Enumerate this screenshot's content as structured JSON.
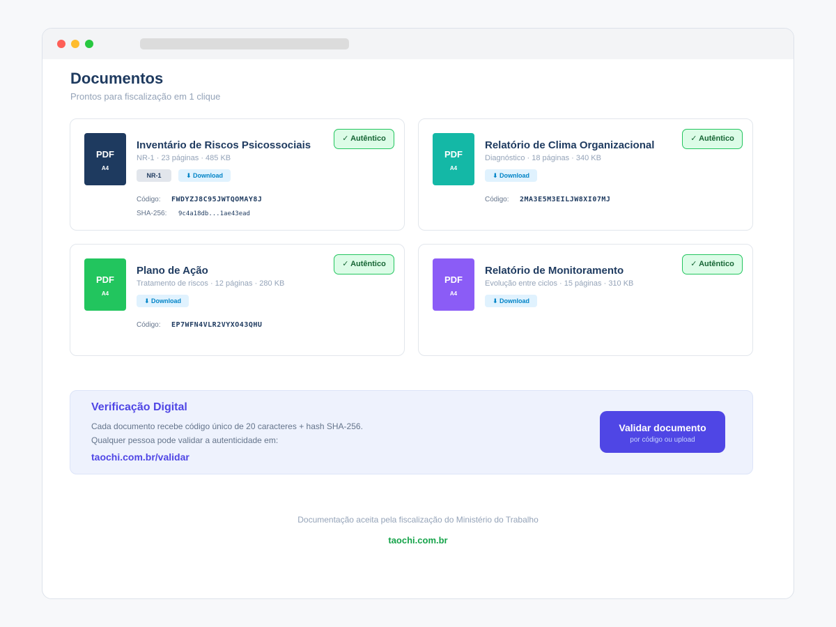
{
  "header": {
    "title": "Documentos",
    "subtitle": "Prontos para fiscalização em 1 clique"
  },
  "documents": [
    {
      "title": "Inventário de Riscos Psicossociais",
      "meta": "NR-1 · 23 páginas · 485 KB",
      "tag": "NR-1",
      "download_label": "⬇ Download",
      "badge": "✓ Autêntico",
      "pdf_label": "PDF",
      "pdf_size": "A4",
      "code_label": "Código:",
      "code": "FWDYZJ8C95JWTQOMAY8J",
      "sha_label": "SHA-256:",
      "sha": "9c4a18db...1ae43ead",
      "color": "#1e3a5f"
    },
    {
      "title": "Relatório de Clima Organizacional",
      "meta": "Diagnóstico · 18 páginas · 340 KB",
      "download_label": "⬇ Download",
      "badge": "✓ Autêntico",
      "pdf_label": "PDF",
      "pdf_size": "A4",
      "code_label": "Código:",
      "code": "2MA3E5M3EILJW8XI07MJ",
      "color": "#14b8a6"
    },
    {
      "title": "Plano de Ação",
      "meta": "Tratamento de riscos · 12 páginas · 280 KB",
      "download_label": "⬇ Download",
      "badge": "✓ Autêntico",
      "pdf_label": "PDF",
      "pdf_size": "A4",
      "code_label": "Código:",
      "code": "EP7WFN4VLR2VYXO43QHU",
      "color": "#22c55e"
    },
    {
      "title": "Relatório de Monitoramento",
      "meta": "Evolução entre ciclos · 15 páginas · 310 KB",
      "download_label": "⬇ Download",
      "badge": "✓ Autêntico",
      "pdf_label": "PDF",
      "pdf_size": "A4",
      "color": "#8b5cf6"
    }
  ],
  "verification": {
    "title": "Verificação Digital",
    "line1": "Cada documento recebe código único de 20 caracteres + hash SHA-256.",
    "line2": "Qualquer pessoa pode validar a autenticidade em:",
    "link": "taochi.com.br/validar",
    "button_label": "Validar documento",
    "button_sublabel": "por código ou upload"
  },
  "footer": {
    "text": "Documentação aceita pela fiscalização do Ministério do Trabalho",
    "link": "taochi.com.br"
  }
}
